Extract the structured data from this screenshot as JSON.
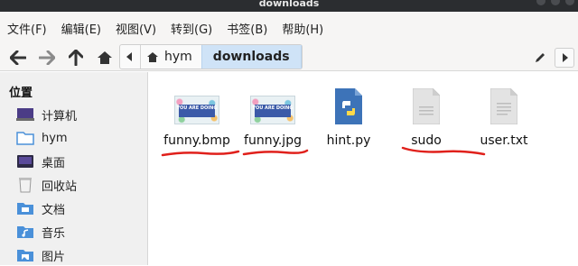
{
  "window": {
    "title": "downloads"
  },
  "menu": [
    "文件(F)",
    "编辑(E)",
    "视图(V)",
    "转到(G)",
    "书签(B)",
    "帮助(H)"
  ],
  "pathbar": {
    "crumbs": [
      "hym",
      "downloads"
    ],
    "active_index": 1
  },
  "sidebar": {
    "header": "位置",
    "items": [
      {
        "label": "计算机",
        "icon": "computer-icon"
      },
      {
        "label": "hym",
        "icon": "home-folder-icon"
      },
      {
        "label": "桌面",
        "icon": "desktop-icon"
      },
      {
        "label": "回收站",
        "icon": "trash-icon"
      },
      {
        "label": "文档",
        "icon": "documents-icon"
      },
      {
        "label": "音乐",
        "icon": "music-icon"
      },
      {
        "label": "图片",
        "icon": "pictures-icon"
      }
    ]
  },
  "files": [
    {
      "name": "funny.bmp",
      "icon": "image-thumbnail-icon",
      "thumb_text": "YOU ARE DOING"
    },
    {
      "name": "funny.jpg",
      "icon": "image-thumbnail-icon",
      "thumb_text": "YOU ARE DOING"
    },
    {
      "name": "hint.py",
      "icon": "python-file-icon"
    },
    {
      "name": "sudo",
      "icon": "generic-file-icon"
    },
    {
      "name": "user.txt",
      "icon": "text-file-icon"
    }
  ],
  "annotations": {
    "underline_color": "#e0201b"
  }
}
